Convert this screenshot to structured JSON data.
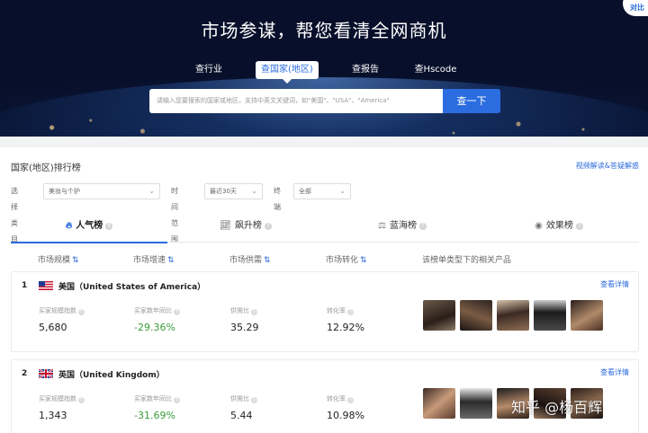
{
  "hero": {
    "title": "市场参谋，帮您看清全网商机",
    "tabs": [
      {
        "label": "查行业",
        "active": false
      },
      {
        "label": "查国家(地区)",
        "active": true
      },
      {
        "label": "查报告",
        "active": false
      },
      {
        "label": "查Hscode",
        "active": false
      }
    ],
    "search_placeholder": "请输入您要搜索的国家或地区，支持中英文关键词，如\"美国\"、\"USA\"、\"America\"",
    "search_button": "查一下",
    "corner_badge": "对比"
  },
  "ranking": {
    "title": "国家(地区)排行榜",
    "help_link": "视频解读&答疑解惑",
    "filters": [
      {
        "label": "选择类目",
        "value": "美妆与个护"
      },
      {
        "label": "时间范围",
        "value": "最近30天"
      },
      {
        "label": "终端",
        "value": "全部"
      }
    ],
    "tabs": [
      {
        "label": "人气榜",
        "icon": "fire-icon",
        "active": true
      },
      {
        "label": "飙升榜",
        "icon": "trend-icon",
        "active": false
      },
      {
        "label": "蓝海榜",
        "icon": "scale-icon",
        "active": false
      },
      {
        "label": "效果榜",
        "icon": "eye-icon",
        "active": false
      }
    ],
    "columns": [
      "市场规模",
      "市场增速",
      "市场供需",
      "市场转化",
      "该榜单类型下的相关产品"
    ],
    "metric_labels": [
      "买家规模指数",
      "买家数年同比",
      "供需比",
      "转化率"
    ],
    "detail_label": "查看详情",
    "rows": [
      {
        "rank": "1",
        "country": "美国（United States of America）",
        "values": [
          "5,680",
          "-29.36%",
          "35.29",
          "12.92%"
        ]
      },
      {
        "rank": "2",
        "country": "英国（United Kingdom）",
        "values": [
          "1,343",
          "-31.69%",
          "5.44",
          "10.98%"
        ]
      }
    ]
  },
  "watermark": "知乎 @杨百辉",
  "colors": {
    "accent": "#2a6bdc",
    "negative": "#3a9c3a"
  }
}
